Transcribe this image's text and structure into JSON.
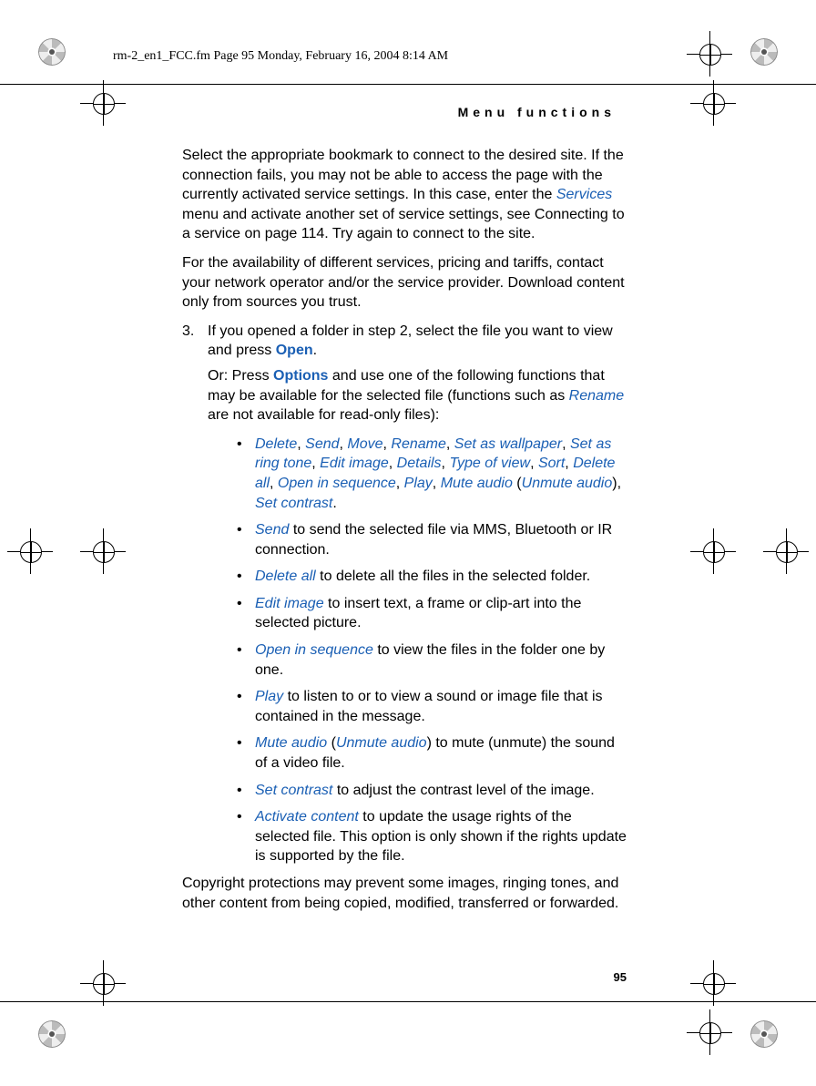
{
  "file_header": "rm-2_en1_FCC.fm  Page 95  Monday, February 16, 2004  8:14 AM",
  "section_header": "Menu functions",
  "page_number": "95",
  "body": {
    "p1a": "Select the appropriate bookmark to connect to the desired site. If the connection fails, you may not be able to access the page with the currently activated service settings. In this case, enter the ",
    "p1_services": "Services",
    "p1b": " menu and activate another set of service settings, see Connecting to a service on page 114. Try again to connect to the site.",
    "p2": "For the availability of different services, pricing and tariffs, contact your network operator and/or the service provider. Download content only from sources you trust.",
    "step3_num": "3.",
    "step3a": "If you opened a folder in step 2, select the file you want to view and press ",
    "step3_open": "Open",
    "step3b": ".",
    "or_a": "Or: Press ",
    "or_options": "Options",
    "or_b": " and use one of the following functions that may be available for the selected file (functions such as ",
    "or_rename": "Rename",
    "or_c": " are not available for read-only files):",
    "b1": {
      "t1": "Delete",
      "t2": "Send",
      "t3": "Move",
      "t4": "Rename",
      "t5": "Set as wallpaper",
      "t6": "Set as ring tone",
      "t7": "Edit image",
      "t8": "Details",
      "t9": "Type of view",
      "t10": "Sort",
      "t11": "Delete all",
      "t12": "Open in sequence",
      "t13": "Play",
      "t14": "Mute audio",
      "t15": "Unmute audio",
      "t16": "Set contrast",
      "sep": ", ",
      "open": " (",
      "close": "), ",
      "dot": "."
    },
    "b2": {
      "term": "Send",
      "text": " to send the selected file via MMS, Bluetooth or IR connection."
    },
    "b3": {
      "term": "Delete all",
      "text": " to delete all the files in the selected folder."
    },
    "b4": {
      "term": "Edit image",
      "text": " to insert text, a frame or clip-art into the selected picture."
    },
    "b5": {
      "term": "Open in sequence",
      "text": " to view the files in the folder one by one."
    },
    "b6": {
      "term": "Play",
      "text": " to listen to or to view a sound or image file that is contained in the message."
    },
    "b7": {
      "term1": "Mute audio",
      "open": " (",
      "term2": "Unmute audio",
      "close": ")",
      "text": " to mute (unmute) the sound of a video file."
    },
    "b8": {
      "term": "Set contrast",
      "text": " to adjust the contrast level of the image."
    },
    "b9": {
      "term": "Activate content",
      "text": " to update the usage rights of the selected file. This option is only shown if the rights update is supported by the file."
    },
    "footer": "Copyright protections may prevent some images, ringing tones, and other content from being copied, modified, transferred or forwarded."
  }
}
